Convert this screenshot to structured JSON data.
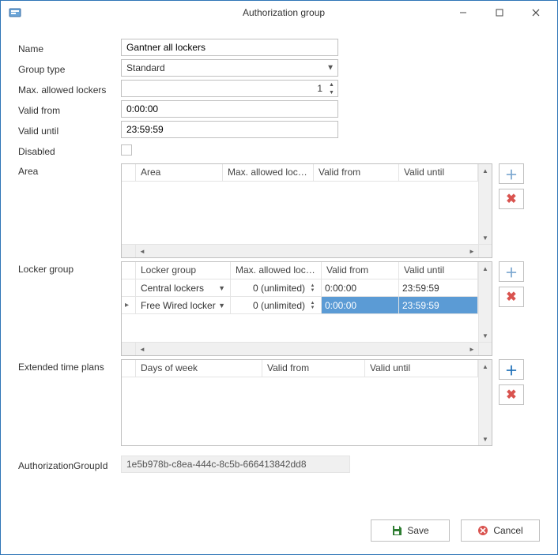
{
  "window": {
    "title": "Authorization group"
  },
  "labels": {
    "name": "Name",
    "group_type": "Group type",
    "max_lockers": "Max. allowed lockers",
    "valid_from": "Valid from",
    "valid_until": "Valid until",
    "disabled": "Disabled",
    "area": "Area",
    "locker_group": "Locker group",
    "etp": "Extended time plans",
    "auth_id": "AuthorizationGroupId"
  },
  "fields": {
    "name": "Gantner all lockers",
    "group_type": "Standard",
    "max_lockers": "1",
    "valid_from": "0:00:00",
    "valid_until": "23:59:59",
    "auth_id": "1e5b978b-c8ea-444c-8c5b-666413842dd8"
  },
  "area_grid": {
    "headers": [
      "Area",
      "Max. allowed lockers",
      "Valid from",
      "Valid until"
    ]
  },
  "lg_grid": {
    "headers": [
      "Locker group",
      "Max. allowed lockers",
      "Valid from",
      "Valid until"
    ],
    "rows": [
      {
        "group": "Central lockers",
        "max": "0 (unlimited)",
        "from": "0:00:00",
        "until": "23:59:59",
        "selected": false,
        "indicator": ""
      },
      {
        "group": "Free Wired locker",
        "max": "0 (unlimited)",
        "from": "0:00:00",
        "until": "23:59:59",
        "selected": true,
        "indicator": "▸"
      }
    ]
  },
  "etp_grid": {
    "headers": [
      "Days of week",
      "Valid from",
      "Valid until"
    ]
  },
  "buttons": {
    "save": "Save",
    "cancel": "Cancel"
  }
}
